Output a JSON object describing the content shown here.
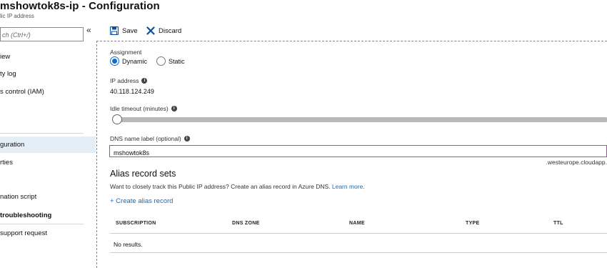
{
  "header": {
    "title": "mshowtok8s-ip - Configuration",
    "subtitle": "lic IP address"
  },
  "sidebar": {
    "search_placeholder": "ch (Ctrl+/)",
    "collapse_glyph": "«",
    "items": [
      {
        "label": "iew"
      },
      {
        "label": "ty log"
      },
      {
        "label": "s control (IAM)"
      },
      {
        "label": "guration",
        "active": true
      },
      {
        "label": "rties"
      },
      {
        "label": "nation script"
      }
    ],
    "section_header": "troubleshooting",
    "support_item": "support request"
  },
  "toolbar": {
    "save_label": "Save",
    "discard_label": "Discard"
  },
  "form": {
    "assignment_label": "Assignment",
    "assignment_options": [
      "Dynamic",
      "Static"
    ],
    "assignment_selected": "Dynamic",
    "ip_label": "IP address",
    "ip_value": "40.118.124.249",
    "idle_label": "Idle timeout (minutes)",
    "idle_slider_level": 0,
    "dns_label": "DNS name label (optional)",
    "dns_value": "mshowtok8s",
    "dns_suffix": ".westeurope.cloudapp."
  },
  "alias": {
    "title": "Alias record sets",
    "description": "Want to closely track this Public IP address? Create an alias record in Azure DNS.",
    "learn_more": "Learn more.",
    "create_label": "+ Create alias record",
    "columns": [
      "SUBSCRIPTION",
      "DNS ZONE",
      "NAME",
      "TYPE",
      "TTL"
    ],
    "empty_text": "No results."
  },
  "colors": {
    "accent": "#0a6ed1",
    "active_nav_bg": "#e4eef7",
    "focus_border": "#a64ea6",
    "dash_border": "#3a9ad9",
    "discard_x": "#0a4fa0"
  },
  "icons": [
    "save-icon",
    "discard-icon",
    "info-icon",
    "chevron-collapse-icon"
  ]
}
